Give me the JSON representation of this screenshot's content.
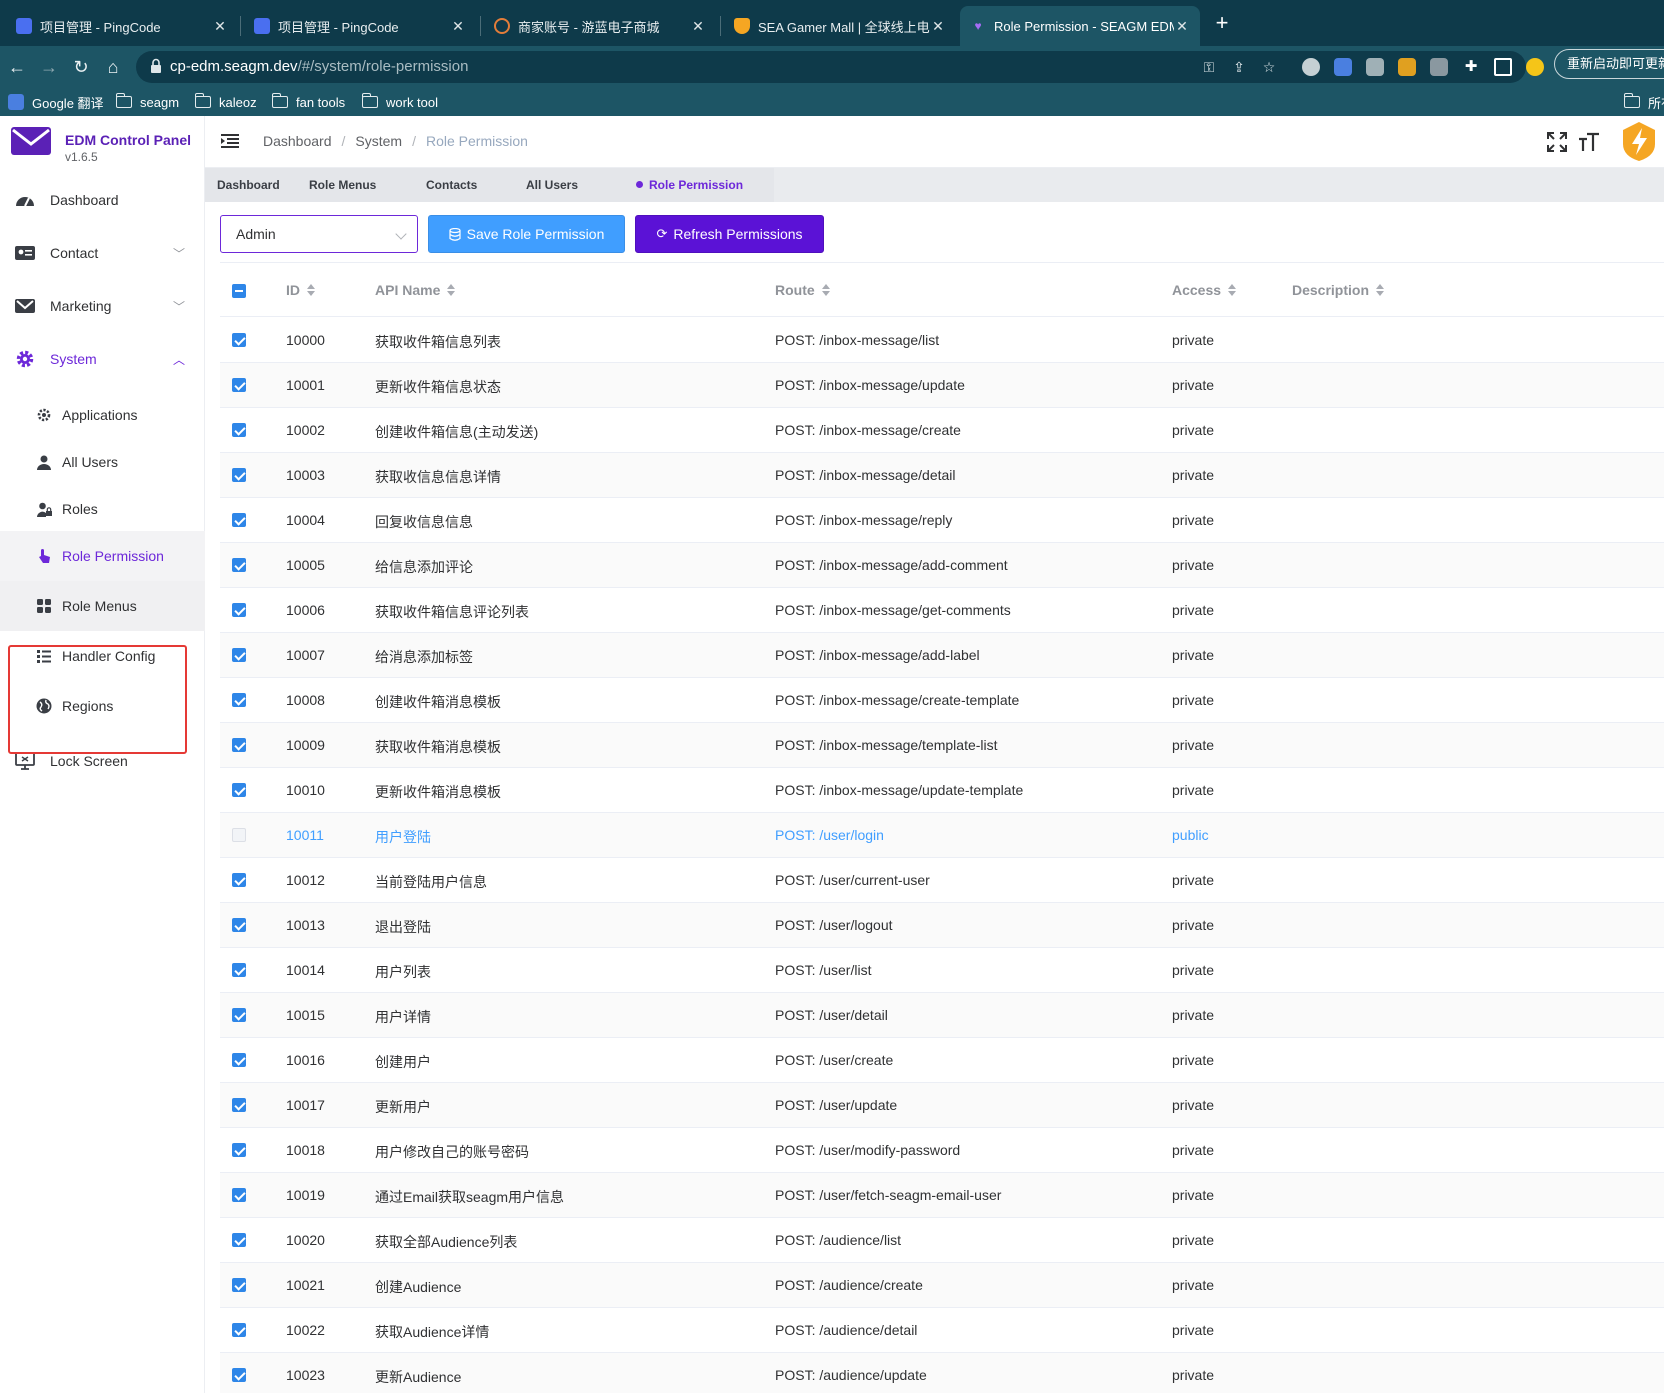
{
  "browser": {
    "tabs": [
      {
        "title": "项目管理 - PingCode",
        "favicon_color": "#4a6ff0"
      },
      {
        "title": "项目管理 - PingCode",
        "favicon_color": "#4a6ff0"
      },
      {
        "title": "商家账号 - 游蓝电子商城",
        "favicon_color": "#e37d3a"
      },
      {
        "title": "SEA Gamer Mall | 全球线上电玩",
        "favicon_color": "#f5a623"
      },
      {
        "title": "Role Permission - SEAGM EDM",
        "favicon_color": "#6d28d9"
      }
    ],
    "url_host": "cp-edm.seagm.dev",
    "url_path": "/#/system/role-permission",
    "relaunch_label": "重新启动即可更新",
    "bookmarks": [
      "Google 翻译",
      "seagm",
      "kaleoz",
      "fan tools",
      "work tool"
    ],
    "other_bookmarks": "所有书签"
  },
  "brand": {
    "name": "EDM Control Panel",
    "version": "v1.6.5",
    "accent": "#6d28d9"
  },
  "sidebar": {
    "items": [
      {
        "label": "Dashboard",
        "icon": "dashboard-icon"
      },
      {
        "label": "Contact",
        "icon": "contact-card-icon"
      },
      {
        "label": "Marketing",
        "icon": "mail-icon"
      },
      {
        "label": "System",
        "icon": "gear-icon"
      }
    ],
    "system_children": [
      {
        "label": "Applications",
        "icon": "apps-gear-icon"
      },
      {
        "label": "All Users",
        "icon": "user-icon"
      },
      {
        "label": "Roles",
        "icon": "user-lock-icon"
      },
      {
        "label": "Role Permission",
        "icon": "finger-touch-icon"
      },
      {
        "label": "Role Menus",
        "icon": "grid-icon"
      },
      {
        "label": "Handler Config",
        "icon": "list-icon"
      },
      {
        "label": "Regions",
        "icon": "globe-icon"
      }
    ],
    "lock_screen": {
      "label": "Lock Screen",
      "icon": "monitor-lock-icon"
    }
  },
  "header": {
    "breadcrumbs": [
      "Dashboard",
      "System",
      "Role Permission"
    ]
  },
  "tags": [
    "Dashboard",
    "Role Menus",
    "Contacts",
    "All Users",
    "Role Permission"
  ],
  "toolbar": {
    "role_select": "Admin",
    "save_label": "Save Role Permission",
    "refresh_label": "Refresh Permissions"
  },
  "table": {
    "columns": [
      "ID",
      "API Name",
      "Route",
      "Access",
      "Description"
    ],
    "rows": [
      {
        "checked": true,
        "id": "10000",
        "name": "获取收件箱信息列表",
        "route": "POST: /inbox-message/list",
        "access": "private"
      },
      {
        "checked": true,
        "id": "10001",
        "name": "更新收件箱信息状态",
        "route": "POST: /inbox-message/update",
        "access": "private"
      },
      {
        "checked": true,
        "id": "10002",
        "name": "创建收件箱信息(主动发送)",
        "route": "POST: /inbox-message/create",
        "access": "private"
      },
      {
        "checked": true,
        "id": "10003",
        "name": "获取收信息信息详情",
        "route": "POST: /inbox-message/detail",
        "access": "private"
      },
      {
        "checked": true,
        "id": "10004",
        "name": "回复收信息信息",
        "route": "POST: /inbox-message/reply",
        "access": "private"
      },
      {
        "checked": true,
        "id": "10005",
        "name": "给信息添加评论",
        "route": "POST: /inbox-message/add-comment",
        "access": "private"
      },
      {
        "checked": true,
        "id": "10006",
        "name": "获取收件箱信息评论列表",
        "route": "POST: /inbox-message/get-comments",
        "access": "private"
      },
      {
        "checked": true,
        "id": "10007",
        "name": "给消息添加标签",
        "route": "POST: /inbox-message/add-label",
        "access": "private"
      },
      {
        "checked": true,
        "id": "10008",
        "name": "创建收件箱消息模板",
        "route": "POST: /inbox-message/create-template",
        "access": "private"
      },
      {
        "checked": true,
        "id": "10009",
        "name": "获取收件箱消息模板",
        "route": "POST: /inbox-message/template-list",
        "access": "private"
      },
      {
        "checked": true,
        "id": "10010",
        "name": "更新收件箱消息模板",
        "route": "POST: /inbox-message/update-template",
        "access": "private"
      },
      {
        "checked": false,
        "id": "10011",
        "name": "用户登陆",
        "route": "POST: /user/login",
        "access": "public"
      },
      {
        "checked": true,
        "id": "10012",
        "name": "当前登陆用户信息",
        "route": "POST: /user/current-user",
        "access": "private"
      },
      {
        "checked": true,
        "id": "10013",
        "name": "退出登陆",
        "route": "POST: /user/logout",
        "access": "private"
      },
      {
        "checked": true,
        "id": "10014",
        "name": "用户列表",
        "route": "POST: /user/list",
        "access": "private"
      },
      {
        "checked": true,
        "id": "10015",
        "name": "用户详情",
        "route": "POST: /user/detail",
        "access": "private"
      },
      {
        "checked": true,
        "id": "10016",
        "name": "创建用户",
        "route": "POST: /user/create",
        "access": "private"
      },
      {
        "checked": true,
        "id": "10017",
        "name": "更新用户",
        "route": "POST: /user/update",
        "access": "private"
      },
      {
        "checked": true,
        "id": "10018",
        "name": "用户修改自己的账号密码",
        "route": "POST: /user/modify-password",
        "access": "private"
      },
      {
        "checked": true,
        "id": "10019",
        "name": "通过Email获取seagm用户信息",
        "route": "POST: /user/fetch-seagm-email-user",
        "access": "private"
      },
      {
        "checked": true,
        "id": "10020",
        "name": "获取全部Audience列表",
        "route": "POST: /audience/list",
        "access": "private"
      },
      {
        "checked": true,
        "id": "10021",
        "name": "创建Audience",
        "route": "POST: /audience/create",
        "access": "private"
      },
      {
        "checked": true,
        "id": "10022",
        "name": "获取Audience详情",
        "route": "POST: /audience/detail",
        "access": "private"
      },
      {
        "checked": true,
        "id": "10023",
        "name": "更新Audience",
        "route": "POST: /audience/update",
        "access": "private"
      }
    ]
  }
}
